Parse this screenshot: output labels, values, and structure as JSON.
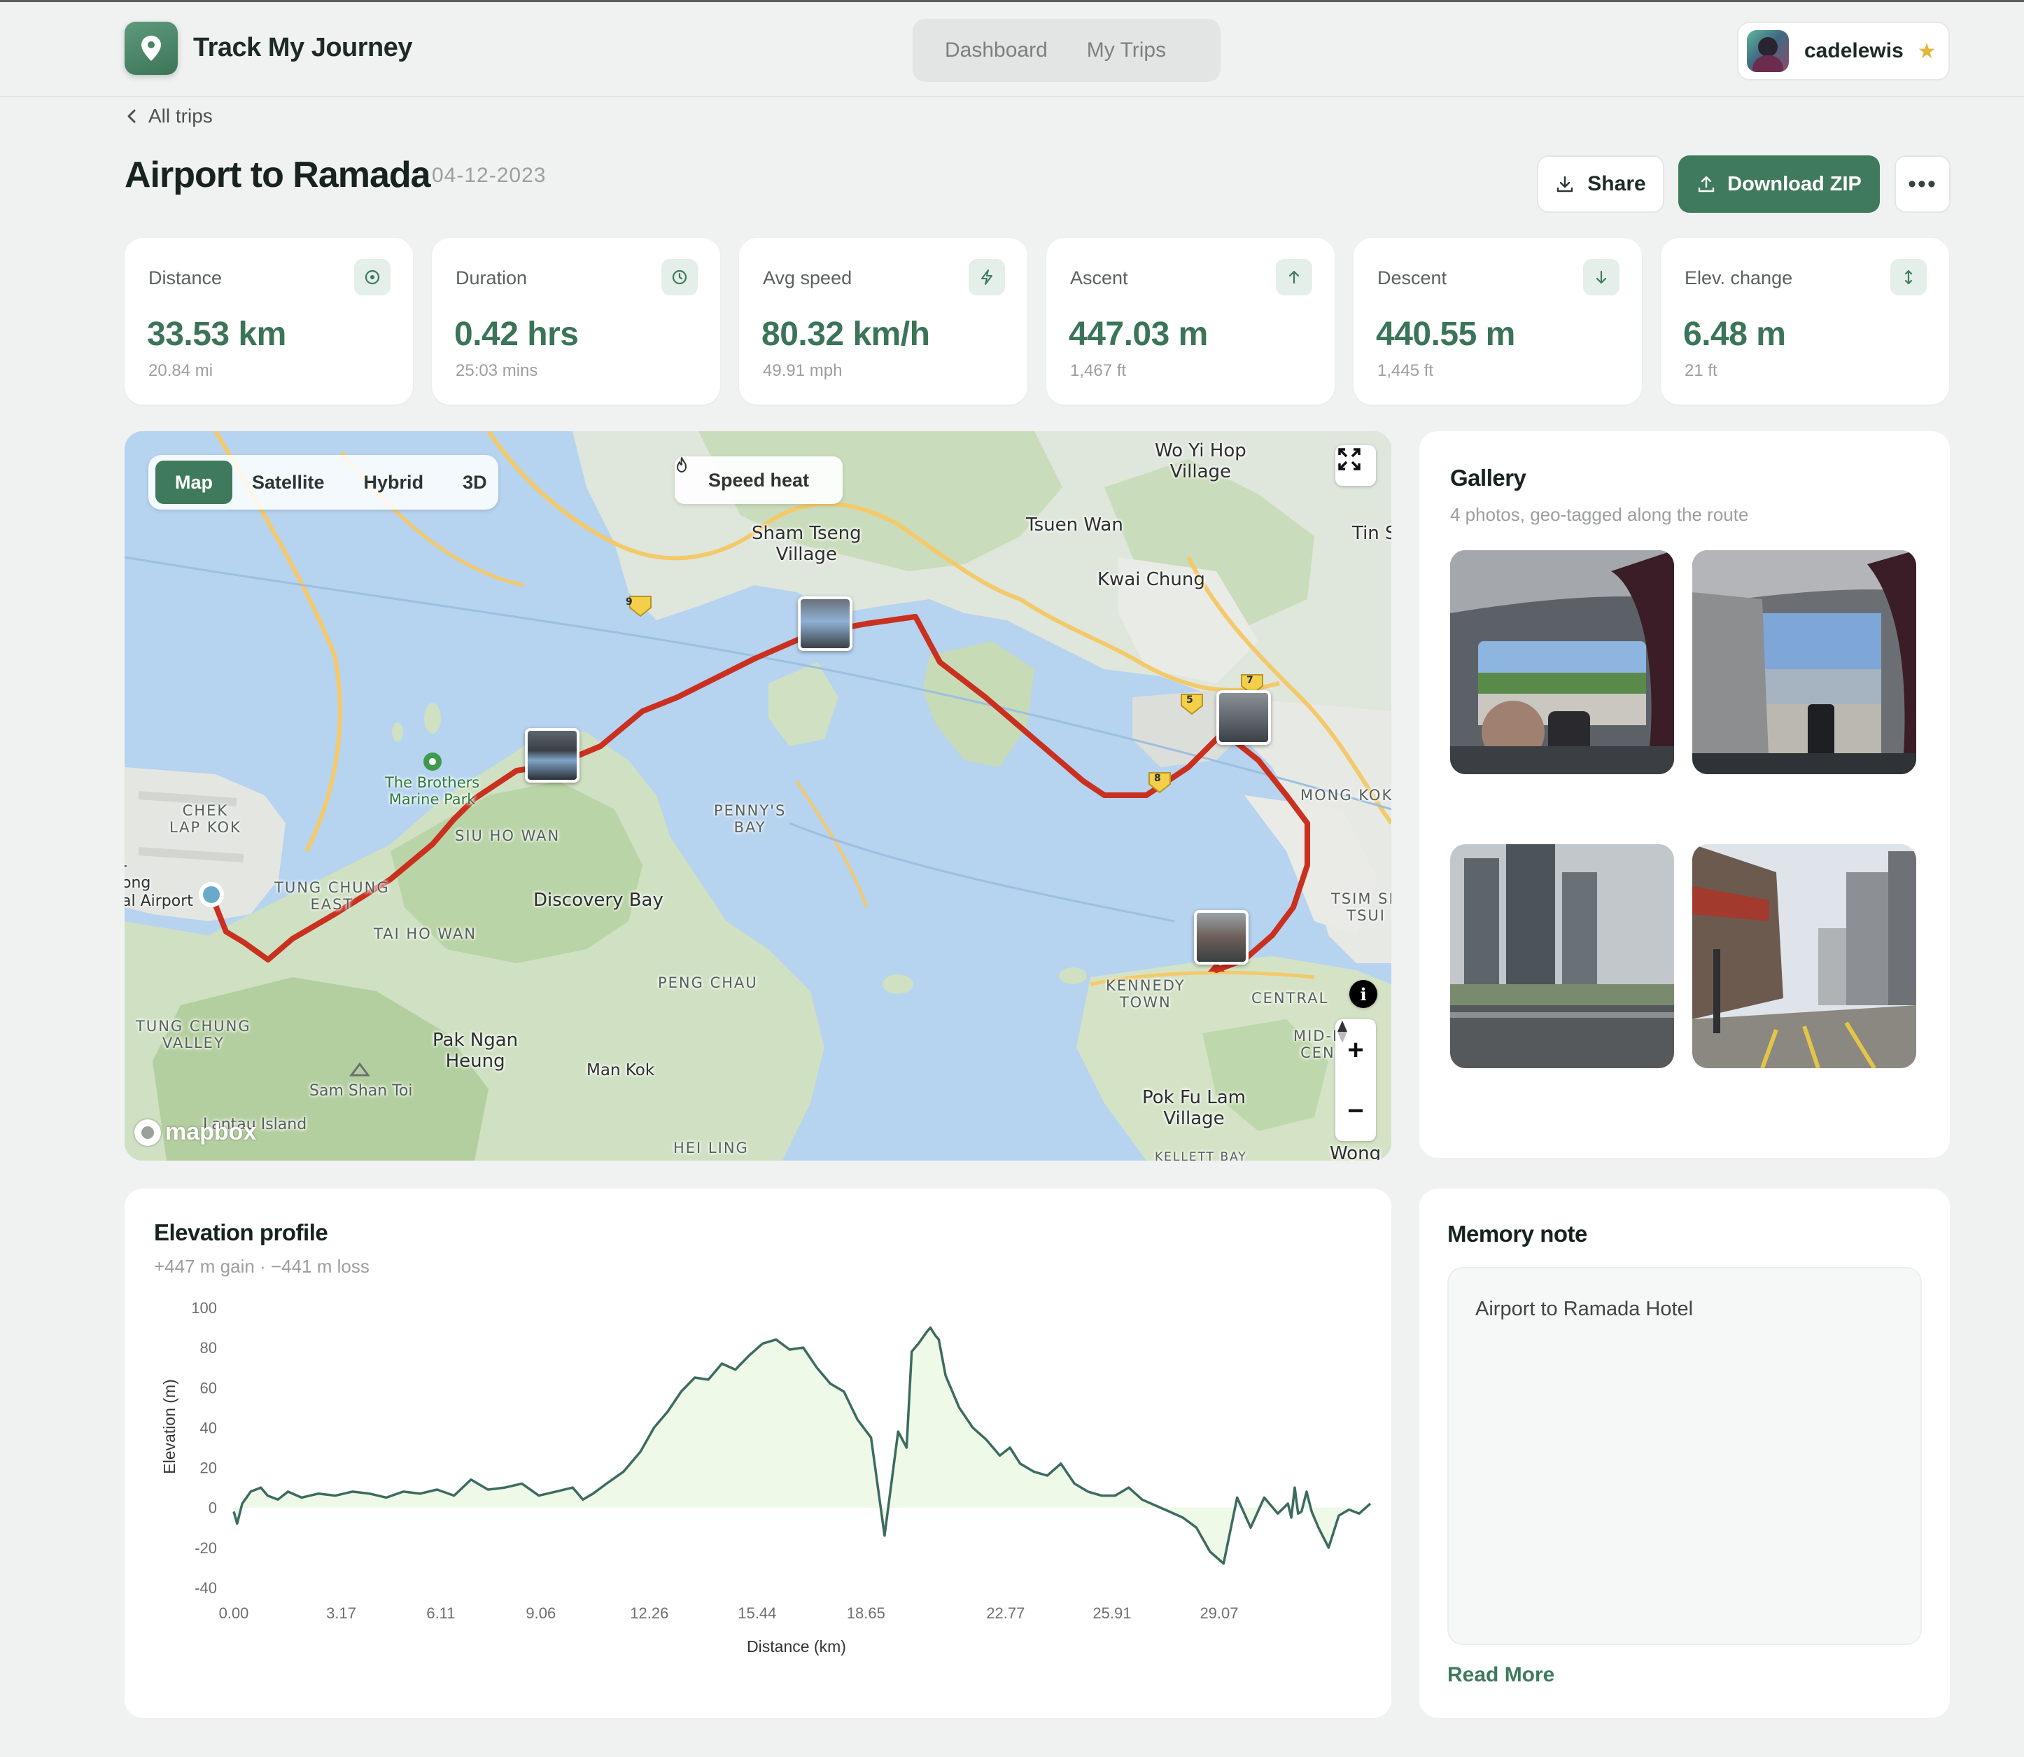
{
  "app": {
    "title": "Track My Journey",
    "accent_color": "#3f7a5c",
    "logo_icon": "map-pin-icon"
  },
  "nav": {
    "tabs": [
      {
        "label": "Dashboard"
      },
      {
        "label": "My Trips"
      }
    ]
  },
  "user": {
    "name": "cadelewis",
    "badge_icon": "star-icon"
  },
  "breadcrumb": {
    "back_label": "All trips"
  },
  "trip": {
    "title": "Airport to Ramada",
    "date": "04-12-2023"
  },
  "actions": {
    "share_label": "Share",
    "download_label": "Download ZIP",
    "more_icon": "more-horizontal-icon"
  },
  "stats": [
    {
      "label": "Distance",
      "value": "33.53 km",
      "sub": "20.84 mi",
      "icon": "target-icon"
    },
    {
      "label": "Duration",
      "value": "0.42 hrs",
      "sub": "25:03 mins",
      "icon": "clock-icon"
    },
    {
      "label": "Avg speed",
      "value": "80.32 km/h",
      "sub": "49.91 mph",
      "icon": "lightning-icon"
    },
    {
      "label": "Ascent",
      "value": "447.03 m",
      "sub": "1,467 ft",
      "icon": "arrow-up-icon"
    },
    {
      "label": "Descent",
      "value": "440.55 m",
      "sub": "1,445 ft",
      "icon": "arrow-down-icon"
    },
    {
      "label": "Elev. change",
      "value": "6.48 m",
      "sub": "21 ft",
      "icon": "arrows-vertical-icon"
    }
  ],
  "map": {
    "modes": [
      "Map",
      "Satellite",
      "Hybrid",
      "3D"
    ],
    "active_mode": "Map",
    "speed_heat_label": "Speed heat",
    "attribution": "mapbox",
    "route_color": "#d23a2a",
    "labels": {
      "wo_yi_hop": "Wo Yi Hop\nVillage",
      "sham_tseng": "Sham Tseng\nVillage",
      "tsuen_wan": "Tsuen Wan",
      "tin_s": "Tin S",
      "kwai_chung": "Kwai Chung",
      "brothers": "The Brothers\nMarine Park",
      "penny_bay": "PENNY'S\nBAY",
      "chek_lap_kok": "CHEK\nLAP KOK",
      "siu_ho_wan": "SIU HO WAN",
      "tung_chung_east": "TUNG CHUNG\nEAST",
      "airport": "-\nong\nal Airport",
      "discovery_bay": "Discovery Bay",
      "tai_ho_wan": "TAI HO WAN",
      "mong_kok": "MONG KOK",
      "tsim_sha_tsui": "TSIM SH\nTSUI",
      "peng_chau": "PENG CHAU",
      "kennedy_town": "KENNEDY\nTOWN",
      "central": "CENTRAL",
      "mid_levels": "MID-L\nCEN",
      "tung_chung_valley": "TUNG CHUNG\nVALLEY",
      "pak_ngan_heung": "Pak Ngan\nHeung",
      "man_kok": "Man Kok",
      "sam_shan_toi": "Sam Shan Toi",
      "lantau": "Lantau Island",
      "pok_fu_lam": "Pok Fu Lam\nVillage",
      "hei_ling": "HEI LING",
      "wong": "Wong",
      "kellett": "KELLETT BAY",
      "road_9": "9",
      "road_5": "5",
      "road_7": "7",
      "road_8": "8"
    }
  },
  "gallery": {
    "title": "Gallery",
    "subtitle": "4 photos, geo-tagged along the route"
  },
  "elevation": {
    "title": "Elevation profile",
    "subtitle": "+447 m gain · −441 m loss"
  },
  "chart_data": {
    "type": "area",
    "title": "Elevation profile",
    "xlabel": "Distance (km)",
    "ylabel": "Elevation (m)",
    "ylim": [
      -40,
      100
    ],
    "yticks": [
      "100",
      "80",
      "60",
      "40",
      "20",
      "0",
      "-20",
      "-40"
    ],
    "xticks": [
      "0.00",
      "3.17",
      "6.11",
      "9.06",
      "12.26",
      "15.44",
      "18.65",
      "22.77",
      "25.91",
      "29.07"
    ],
    "grid": false,
    "line_color": "#3d6b60",
    "fill_color": "#eef9e8",
    "series": [
      {
        "x": [
          0.0,
          0.1,
          0.25,
          0.5,
          0.8,
          1.0,
          1.3,
          1.6,
          2.0,
          2.5,
          3.0,
          3.5,
          4.0,
          4.5,
          5.0,
          5.5,
          6.0,
          6.5,
          7.0,
          7.5,
          8.0,
          8.5,
          9.0,
          9.5,
          10.0,
          10.3,
          10.6,
          11.0,
          11.5,
          12.0,
          12.4,
          12.8,
          13.2,
          13.6,
          14.0,
          14.4,
          14.8,
          15.2,
          15.6,
          16.0,
          16.4,
          16.8,
          17.2,
          17.6,
          18.0,
          18.4,
          18.8,
          19.2,
          19.6,
          19.85,
          20.0,
          20.2,
          20.45,
          20.55,
          20.7,
          20.8,
          21.0,
          21.4,
          21.8,
          22.2,
          22.6,
          22.9,
          23.2,
          23.6,
          24.0,
          24.4,
          24.8,
          25.2,
          25.6,
          26.0,
          26.4,
          26.8,
          27.2,
          27.6,
          28.0,
          28.4,
          28.8,
          29.2,
          29.6,
          30.0,
          30.4,
          30.8,
          31.1,
          31.2,
          31.3,
          31.4,
          31.5,
          31.65,
          31.8,
          32.0,
          32.3,
          32.6,
          32.9,
          33.2,
          33.53
        ],
        "values": [
          -2,
          -8,
          2,
          8,
          10,
          6,
          4,
          8,
          5,
          7,
          6,
          8,
          7,
          5,
          8,
          7,
          9,
          6,
          14,
          9,
          10,
          12,
          6,
          8,
          10,
          4,
          7,
          12,
          18,
          28,
          40,
          48,
          58,
          65,
          64,
          72,
          69,
          76,
          82,
          84,
          79,
          80,
          70,
          62,
          58,
          44,
          35,
          -14,
          38,
          30,
          78,
          82,
          88,
          90,
          86,
          84,
          66,
          50,
          40,
          34,
          26,
          30,
          22,
          18,
          16,
          22,
          12,
          8,
          6,
          6,
          10,
          4,
          1,
          -2,
          -5,
          -10,
          -22,
          -28,
          5,
          -10,
          5,
          -3,
          2,
          -5,
          10,
          -3,
          -2,
          8,
          -2,
          -10,
          -20,
          -4,
          -1,
          -3,
          2
        ]
      }
    ]
  },
  "memory": {
    "title": "Memory note",
    "text": "Airport to Ramada Hotel",
    "read_more_label": "Read More"
  }
}
